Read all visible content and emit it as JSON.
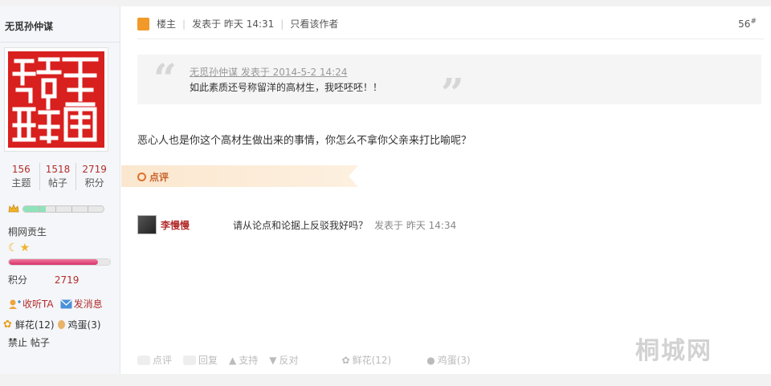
{
  "author": {
    "name": "无觅孙仲谋",
    "stats": [
      {
        "value": "156",
        "label": "主题"
      },
      {
        "value": "1518",
        "label": "帖子"
      },
      {
        "value": "2719",
        "label": "积分"
      }
    ],
    "level_progress": 0.28,
    "group_name": "桐网贡生",
    "points_label": "积分",
    "points_value": "2719",
    "points_progress": 0.88,
    "follow_label": "收听TA",
    "message_label": "发消息",
    "flowers_label": "鲜花(12)",
    "eggs_label": "鸡蛋(3)",
    "ban_label": "禁止 帖子"
  },
  "post": {
    "owner_label": "楼主",
    "posted_label": "发表于 昨天 14:31",
    "only_author_label": "只看该作者",
    "floor_number": "56",
    "floor_suffix": "#",
    "quote_meta": "无觅孙仲谋 发表于 2014-5-2 14:24",
    "quote_text": "如此素质还号称留洋的高材生，我呸呸呸！！",
    "content": "恶心人也是你这个高材生做出来的事情，你怎么不拿你父亲来打比喻呢？"
  },
  "comments": {
    "section_label": "点评",
    "items": [
      {
        "user": "李慢慢",
        "text": "请从论点和论据上反驳我好吗？",
        "time": "发表于 昨天 14:34"
      }
    ]
  },
  "actions": {
    "comment": "点评",
    "reply": "回复",
    "support": "支持",
    "oppose": "反对",
    "flowers": "鲜花(12)",
    "eggs": "鸡蛋(3)"
  },
  "watermark": "桐城网",
  "colors": {
    "accent": "#b32d2d",
    "seal": "#d8201f",
    "comment_bar": "#fbe7cf"
  }
}
